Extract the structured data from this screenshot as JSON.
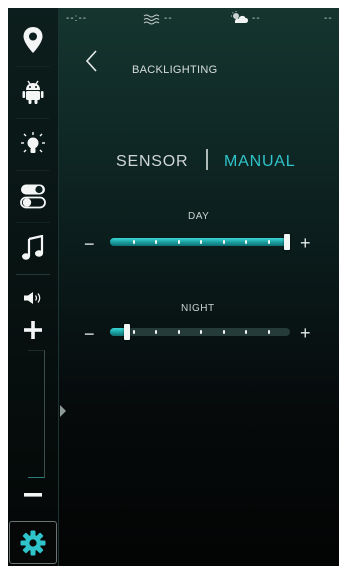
{
  "status": {
    "clock": "--:--",
    "water_temp": "--",
    "weather": "--",
    "right": "--"
  },
  "sidebar": {
    "items": [
      {
        "icon": "location-pin-icon"
      },
      {
        "icon": "android-icon"
      },
      {
        "icon": "light-bulb-icon"
      },
      {
        "icon": "toggle-switches-icon"
      },
      {
        "icon": "music-note-icon"
      }
    ],
    "volume": {
      "icon": "speaker-icon",
      "plus": "+",
      "minus": "−"
    },
    "settings_icon": "gear-icon"
  },
  "page": {
    "title": "BACKLIGHTING"
  },
  "mode": {
    "sensor": "SENSOR",
    "manual": "MANUAL",
    "active": "MANUAL"
  },
  "sliders": {
    "day": {
      "label": "DAY",
      "level": 1.0,
      "minus": "−",
      "plus": "+"
    },
    "night": {
      "label": "NIGHT",
      "level": 0.08,
      "minus": "−",
      "plus": "+"
    }
  },
  "colors": {
    "accent": "#2fc4c9",
    "text": "#d6dddc",
    "background_top": "#16352f",
    "background_bottom": "#030404"
  }
}
